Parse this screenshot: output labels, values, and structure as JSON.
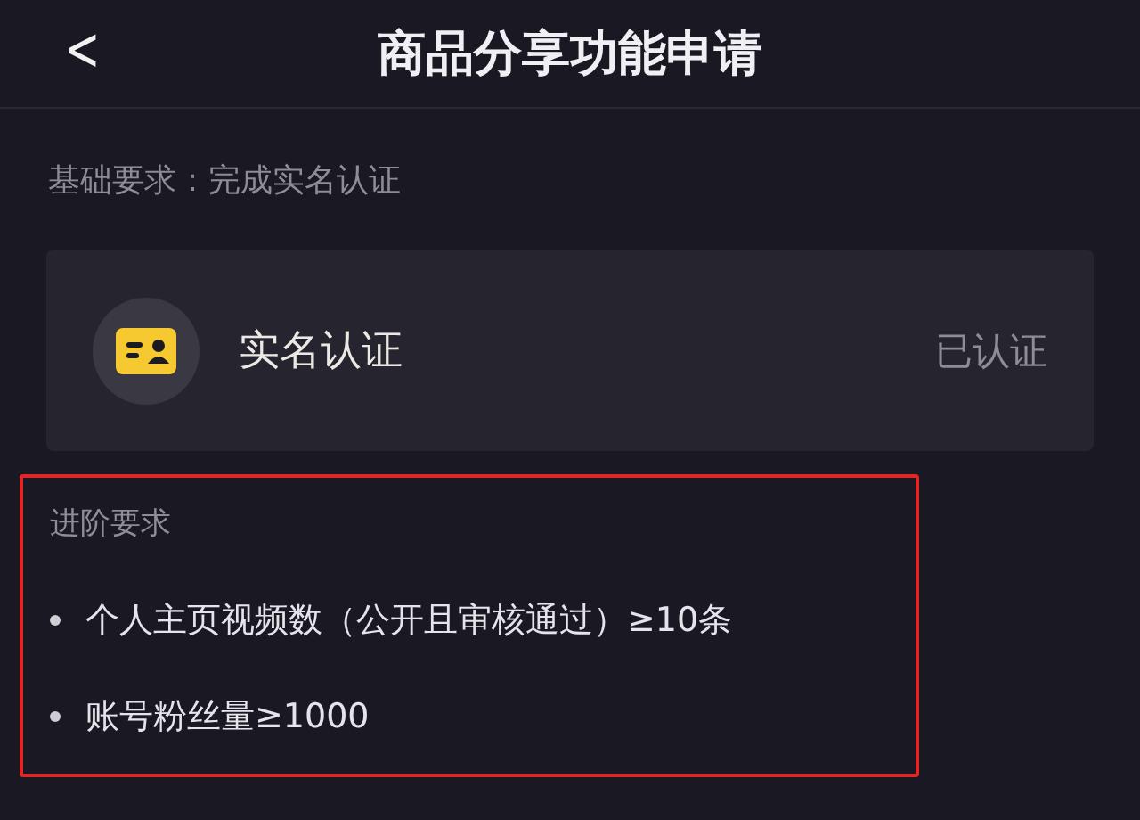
{
  "header": {
    "back": "<",
    "title": "商品分享功能申请"
  },
  "basic_requirement": "基础要求：完成实名认证",
  "verification_card": {
    "label": "实名认证",
    "status": "已认证"
  },
  "advanced_requirements": {
    "title": "进阶要求",
    "highlighted": true,
    "items": [
      "个人主页视频数（公开且审核通过）≥10条",
      "账号粉丝量≥1000"
    ]
  }
}
